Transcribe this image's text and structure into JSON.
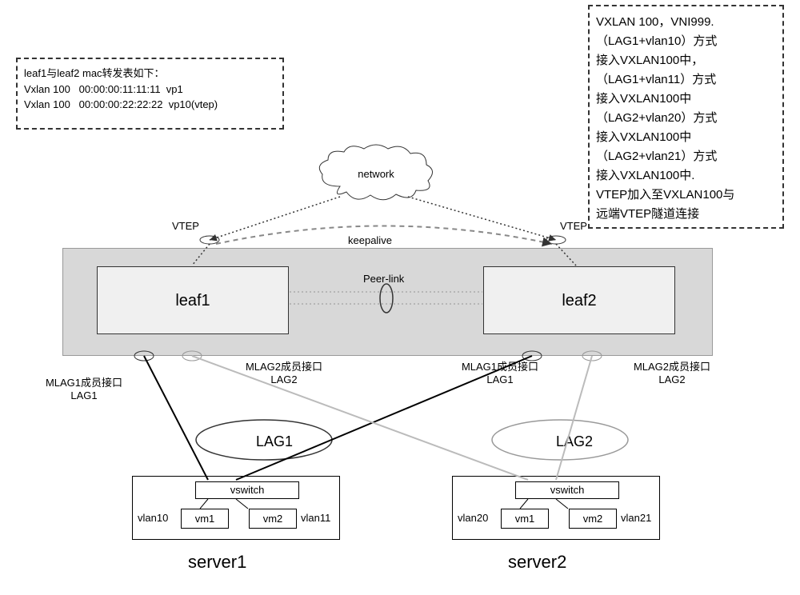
{
  "mac_table": {
    "title": "leaf1与leaf2 mac转发表如下：",
    "row1": "Vxlan 100   00:00:00:11:11:11  vp1",
    "row2": "Vxlan 100   00:00:00:22:22:22  vp10(vtep)"
  },
  "config_box": {
    "line1": "VXLAN 100，VNI999.",
    "line2": "（LAG1+vlan10）方式",
    "line3": "接入VXLAN100中，",
    "line4": "（LAG1+vlan11）方式",
    "line5": "接入VXLAN100中",
    "line6": "（LAG2+vlan20）方式",
    "line7": "接入VXLAN100中",
    "line8": "（LAG2+vlan21）方式",
    "line9": "接入VXLAN100中.",
    "line10": "VTEP加入至VXLAN100与",
    "line11": "远端VTEP隧道连接"
  },
  "network_cloud": "network",
  "vtep1": "VTEP",
  "vtep2": "VTEP",
  "keepalive": "keepalive",
  "peerlink": "Peer-link",
  "leaf1": "leaf1",
  "leaf2": "leaf2",
  "mlag1_lag1": "MLAG1成员接口LAG1",
  "mlag2_lag2_left": "MLAG2成员接口LAG2",
  "mlag1_lag1_right": "MLAG1成员接口LAG1",
  "mlag2_lag2_right": "MLAG2成员接口LAG2",
  "lag1": "LAG1",
  "lag2": "LAG2",
  "server1": {
    "vswitch": "vswitch",
    "vm1": "vm1",
    "vm2": "vm2",
    "vlan10": "vlan10",
    "vlan11": "vlan11",
    "label": "server1"
  },
  "server2": {
    "vswitch": "vswitch",
    "vm1": "vm1",
    "vm2": "vm2",
    "vlan20": "vlan20",
    "vlan21": "vlan21",
    "label": "server2"
  }
}
